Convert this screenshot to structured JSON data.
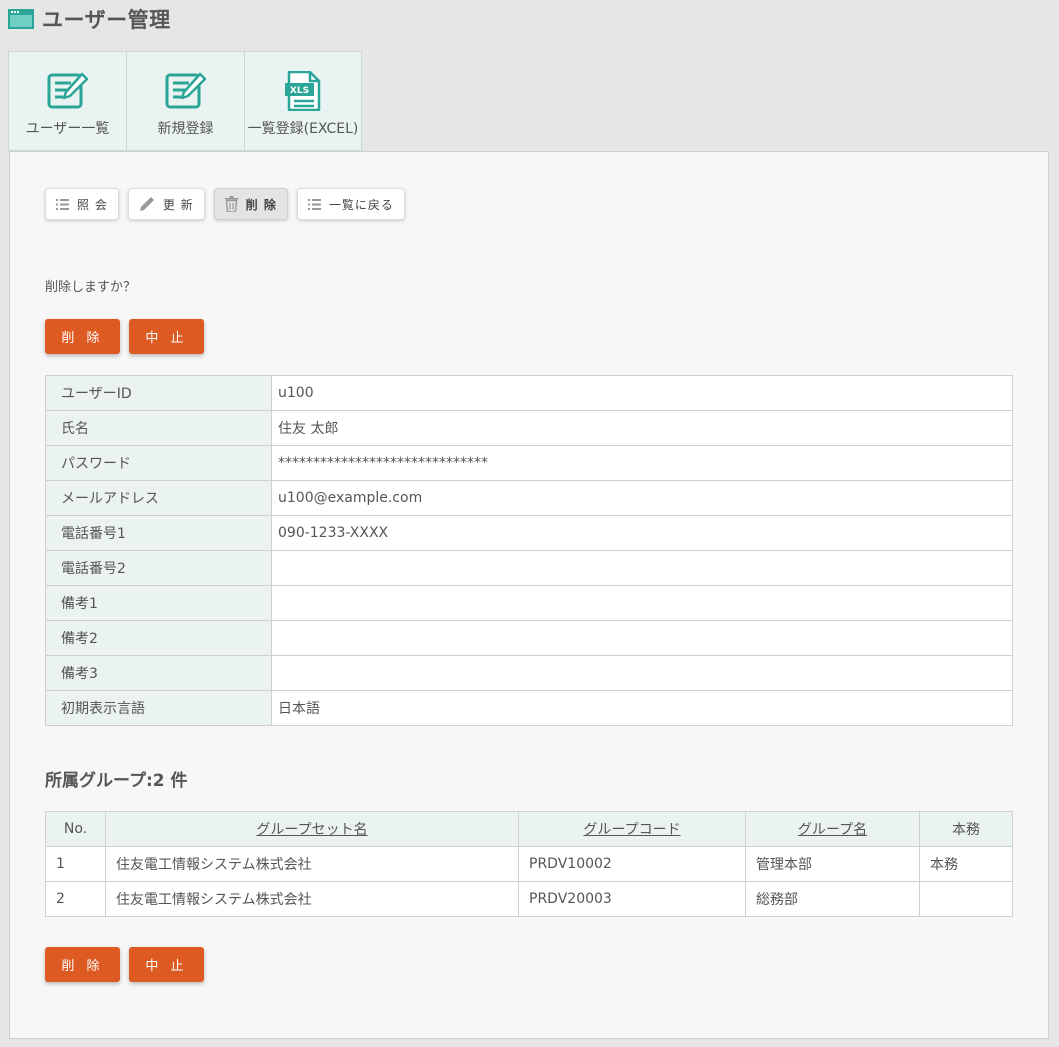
{
  "header": {
    "title": "ユーザー管理"
  },
  "tabs": [
    {
      "label": "ユーザー一覧",
      "icon": "edit-document-icon"
    },
    {
      "label": "新規登録",
      "icon": "edit-document-icon"
    },
    {
      "label": "一覧登録(EXCEL)",
      "icon": "xls-file-icon"
    }
  ],
  "toolbar": {
    "view": "照 会",
    "update": "更 新",
    "delete": "削 除",
    "back": "一覧に戻る"
  },
  "confirm_message": "削除しますか？",
  "actions": {
    "delete": "削 除",
    "cancel": "中 止"
  },
  "details": [
    {
      "label": "ユーザーID",
      "value": "u100"
    },
    {
      "label": "氏名",
      "value": "住友 太郎"
    },
    {
      "label": "パスワード",
      "value": "******************************"
    },
    {
      "label": "メールアドレス",
      "value": "u100@example.com"
    },
    {
      "label": "電話番号1",
      "value": "090-1233-XXXX"
    },
    {
      "label": "電話番号2",
      "value": ""
    },
    {
      "label": "備考1",
      "value": ""
    },
    {
      "label": "備考2",
      "value": ""
    },
    {
      "label": "備考3",
      "value": ""
    },
    {
      "label": "初期表示言語",
      "value": "日本語"
    }
  ],
  "groups_section": {
    "title": "所属グループ:2 件",
    "columns": [
      "No.",
      "グループセット名",
      "グループコード",
      "グループ名",
      "本務"
    ],
    "rows": [
      [
        "1",
        "住友電工情報システム株式会社",
        "PRDV10002",
        "管理本部",
        "本務"
      ],
      [
        "2",
        "住友電工情報システム株式会社",
        "PRDV20003",
        "総務部",
        ""
      ]
    ]
  },
  "colors": {
    "accent": "#dd5a22",
    "teal": "#2aa597",
    "label_bg": "#eaf3f2"
  }
}
